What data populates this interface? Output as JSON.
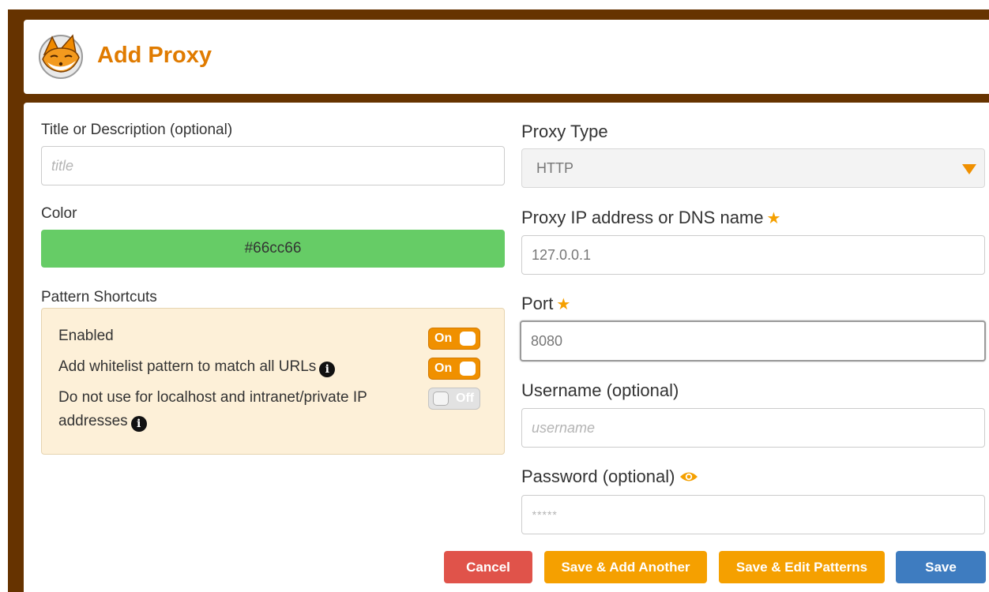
{
  "header": {
    "title": "Add Proxy",
    "logo_icon": "fox-logo-icon"
  },
  "left": {
    "title_label": "Title or Description (optional)",
    "title_placeholder": "title",
    "color_label": "Color",
    "color_value": "#66cc66",
    "pattern_label": "Pattern Shortcuts",
    "patterns": [
      {
        "label": "Enabled",
        "state": "On",
        "info": false
      },
      {
        "label": "Add whitelist pattern to match all URLs",
        "state": "On",
        "info": true
      },
      {
        "label": "Do not use for localhost and intranet/private IP",
        "label_line2": "addresses",
        "state": "Off",
        "info": true
      }
    ]
  },
  "right": {
    "proxy_type_label": "Proxy Type",
    "proxy_type_value": "HTTP",
    "ip_label": "Proxy IP address or DNS name",
    "ip_value": "127.0.0.1",
    "port_label": "Port",
    "port_value": "8080",
    "username_label": "Username (optional)",
    "username_placeholder": "username",
    "password_label": "Password (optional)",
    "password_value": "*****"
  },
  "buttons": {
    "cancel": "Cancel",
    "save_add_another": "Save & Add Another",
    "save_edit_patterns": "Save & Edit Patterns",
    "save": "Save"
  },
  "colors": {
    "frame": "#663300",
    "title": "#e07b00",
    "accent": "#f09000",
    "cancel": "#e0534a",
    "save": "#3e7cc0",
    "pattern_bg": "#fdf0d8",
    "color_swatch": "#66cc66"
  }
}
